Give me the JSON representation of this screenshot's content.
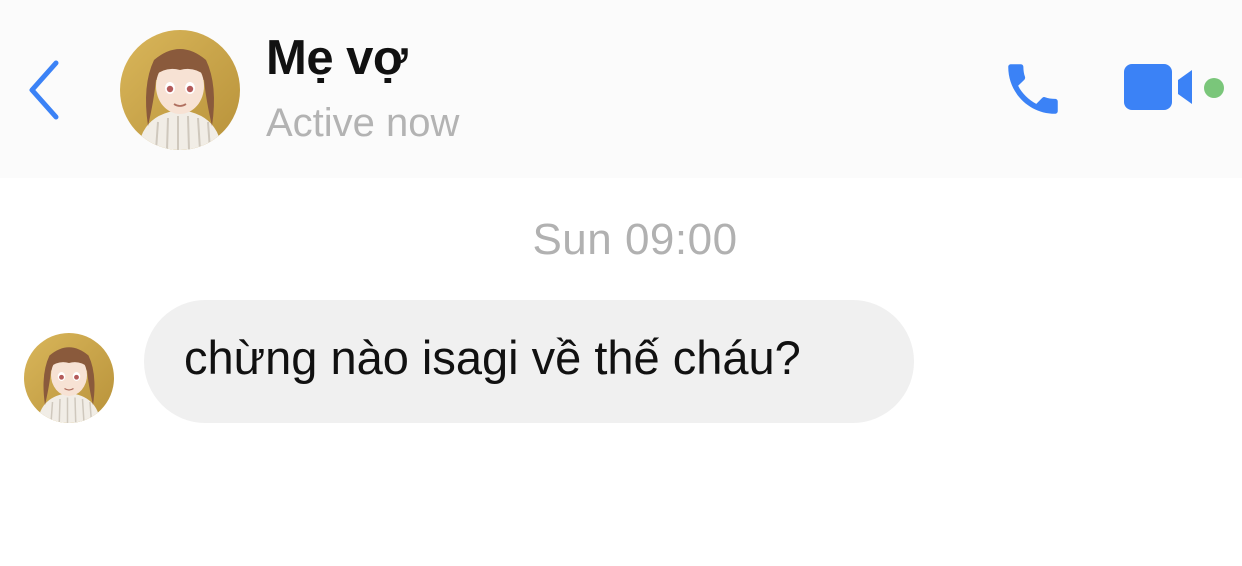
{
  "header": {
    "back_icon": "chevron-left-icon",
    "contact_name": "Mẹ vợ",
    "status": "Active now",
    "call_icon": "phone-icon",
    "video_icon": "video-camera-icon",
    "online_dot_color": "#7ac67a"
  },
  "conversation": {
    "timestamp": "Sun 09:00",
    "messages": [
      {
        "sender": "Mẹ vợ",
        "direction": "incoming",
        "text": "chừng nào isagi về thế cháu?"
      }
    ]
  },
  "colors": {
    "accent": "#3b82f6",
    "bubble_incoming": "#f0f0f0",
    "muted_text": "#b3b3b3"
  }
}
